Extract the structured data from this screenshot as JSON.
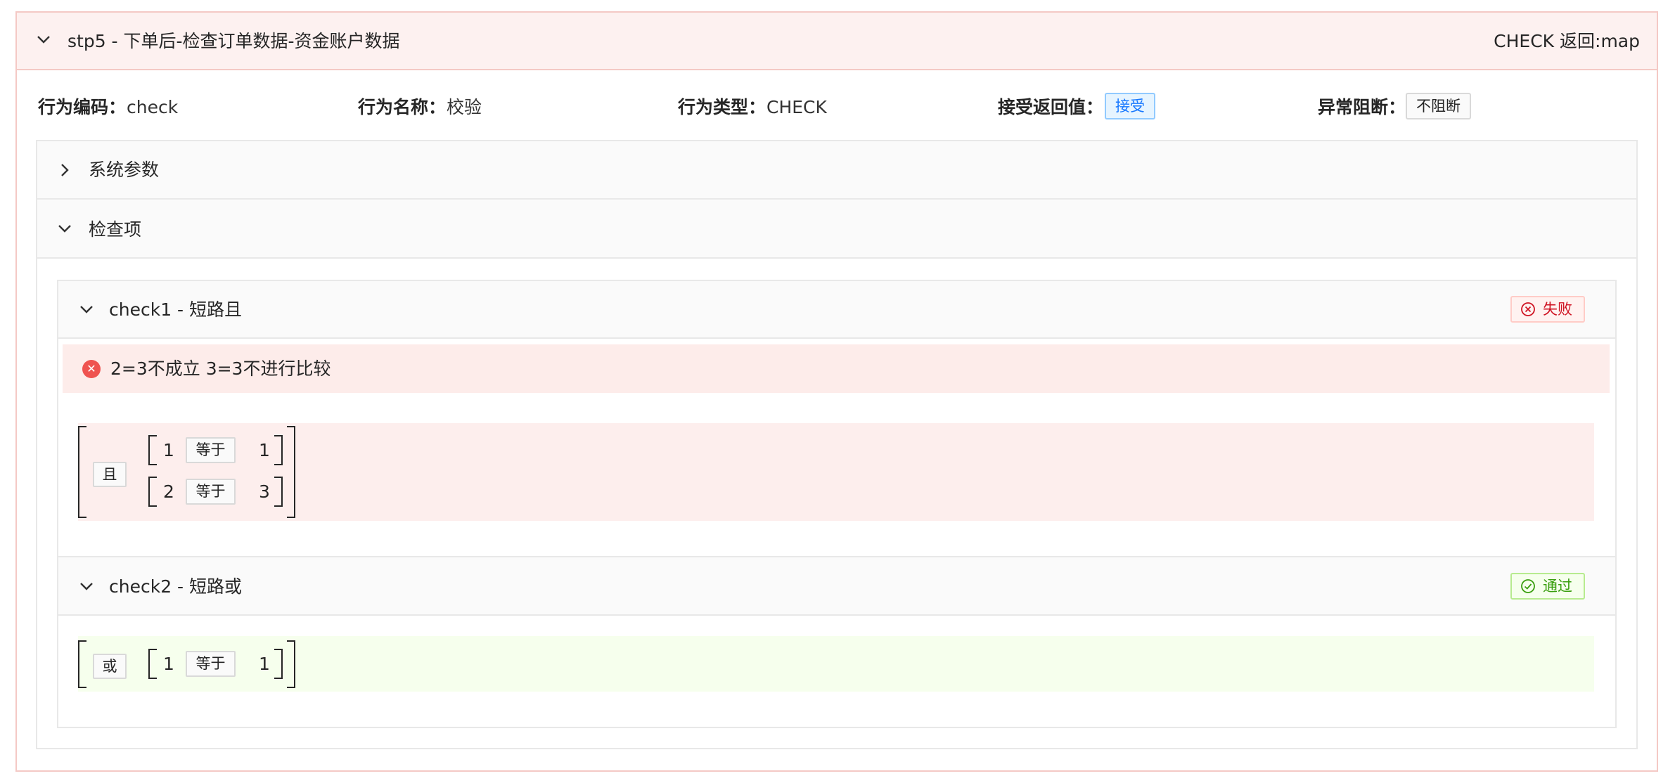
{
  "step": {
    "title": "stp5 - 下单后-检查订单数据-资金账户数据",
    "right_text": "CHECK 返回:map"
  },
  "meta": {
    "code_label": "行为编码",
    "code_value": "check",
    "name_label": "行为名称",
    "name_value": "校验",
    "type_label": "行为类型",
    "type_value": "CHECK",
    "accept_label": "接受返回值",
    "accept_value": "接受",
    "block_label": "异常阻断",
    "block_value": "不阻断",
    "separator": "："
  },
  "panels": {
    "system_params": "系统参数",
    "check_items": "检查项"
  },
  "check1": {
    "title": "check1 - 短路且",
    "status": "失败",
    "error_message": "2=3不成立 3=3不进行比较",
    "logic": "且",
    "conditions": [
      {
        "left": "1",
        "op": "等于",
        "right": "1"
      },
      {
        "left": "2",
        "op": "等于",
        "right": "3"
      }
    ]
  },
  "check2": {
    "title": "check2 - 短路或",
    "status": "通过",
    "logic": "或",
    "conditions": [
      {
        "left": "1",
        "op": "等于",
        "right": "1"
      }
    ]
  },
  "colors": {
    "fail_bg": "#fdeeed",
    "pass_bg": "#f6ffed",
    "accent_blue": "#1677ff",
    "error_red": "#ef5350",
    "success_green": "#389e0d"
  },
  "icons": {
    "expanded": "chevron-down-icon",
    "collapsed": "chevron-right-icon",
    "fail": "close-circle-icon",
    "pass": "check-circle-icon"
  }
}
